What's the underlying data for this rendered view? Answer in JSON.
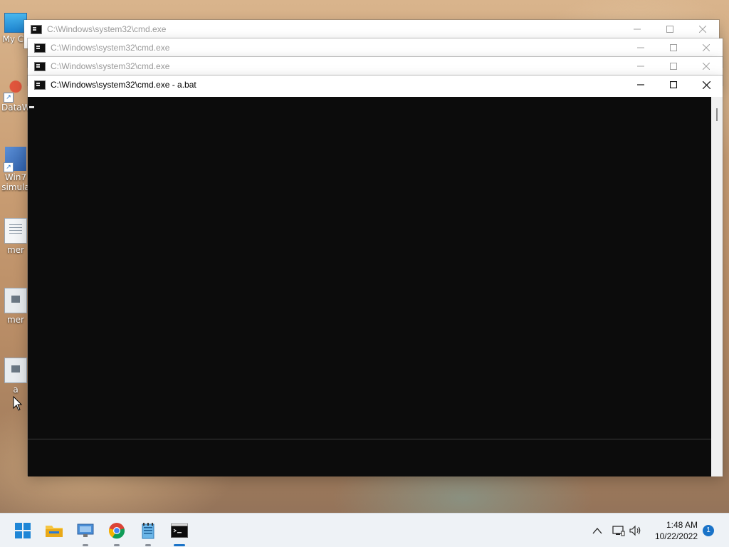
{
  "desktop": {
    "icons": [
      {
        "label": "My Co",
        "kind": "pc-icon"
      },
      {
        "label": "DataW",
        "kind": "app-shortcut-icon"
      },
      {
        "label": "Win7 simula",
        "kind": "app-shortcut-icon"
      },
      {
        "label": "mer",
        "kind": "document-icon"
      },
      {
        "label": "mer",
        "kind": "batch-file-icon"
      },
      {
        "label": "a",
        "kind": "batch-file-icon"
      }
    ]
  },
  "windows": [
    {
      "title": "C:\\Windows\\system32\\cmd.exe",
      "active": false
    },
    {
      "title": "C:\\Windows\\system32\\cmd.exe",
      "active": false
    },
    {
      "title": "C:\\Windows\\system32\\cmd.exe",
      "active": false
    },
    {
      "title": "C:\\Windows\\system32\\cmd.exe - a.bat",
      "active": true
    }
  ],
  "taskbar": {
    "apps": [
      {
        "name": "start",
        "icon": "windows-start-icon"
      },
      {
        "name": "file-explorer",
        "icon": "folder-icon"
      },
      {
        "name": "remote-desktop",
        "icon": "remote-desktop-icon"
      },
      {
        "name": "chrome",
        "icon": "chrome-icon"
      },
      {
        "name": "notepad",
        "icon": "notepad-icon"
      },
      {
        "name": "command-prompt",
        "icon": "cmd-icon"
      }
    ],
    "clock": {
      "time": "1:48 AM",
      "date": "10/22/2022"
    },
    "notification_count": "1"
  },
  "colors": {
    "console_bg": "#0c0c0c",
    "taskbar_bg": "#eef2f6",
    "accent": "#1a73c8"
  }
}
